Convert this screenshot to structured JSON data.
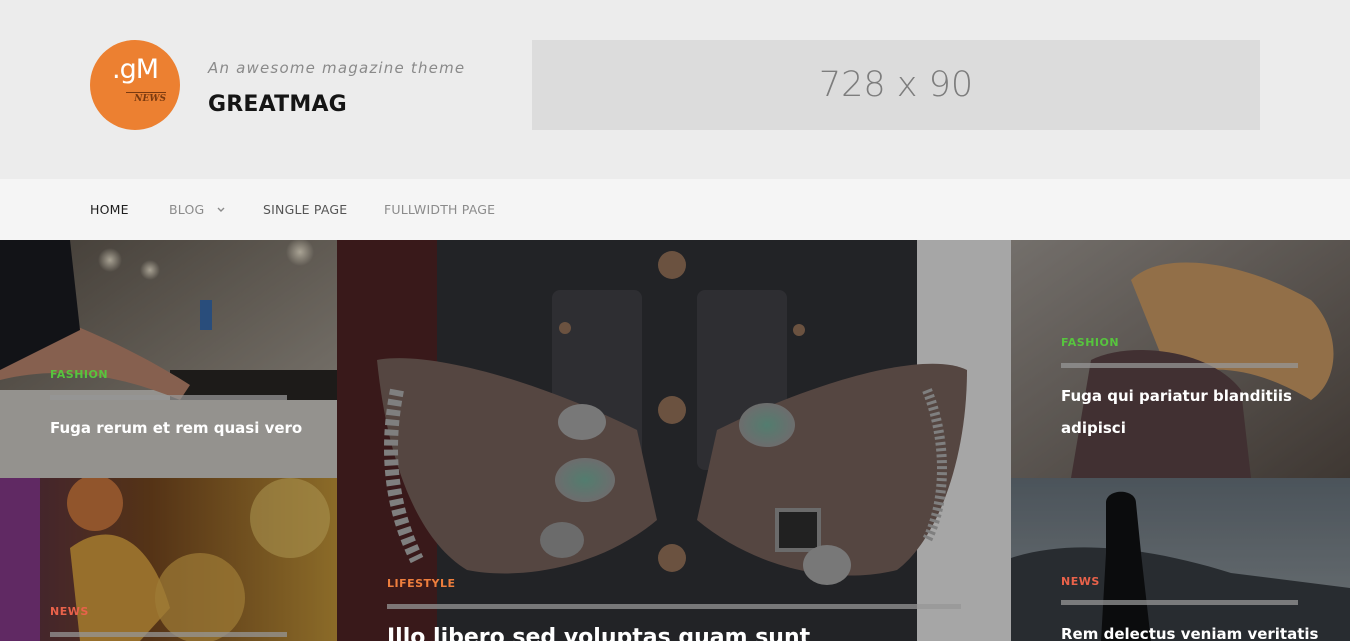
{
  "site": {
    "logo_mark": ".gM",
    "logo_sub": "NEWS",
    "tagline": "An awesome magazine theme",
    "title": "GREATMAG",
    "ad_label": "728 x 90"
  },
  "nav": {
    "items": [
      {
        "label": "HOME"
      },
      {
        "label": "BLOG"
      },
      {
        "label": "SINGLE PAGE"
      },
      {
        "label": "FULLWIDTH PAGE"
      }
    ]
  },
  "posts": [
    {
      "category": "FASHION",
      "title": "Fuga rerum et rem quasi vero"
    },
    {
      "category": "NEWS",
      "title": ""
    },
    {
      "category": "LIFESTYLE",
      "title": "Illo libero sed voluptas quam sunt"
    },
    {
      "category": "FASHION",
      "title": "Fuga qui pariatur blanditiis adipisci"
    },
    {
      "category": "NEWS",
      "title": "Rem delectus veniam veritatis"
    }
  ],
  "colors": {
    "accent_orange": "#ec8031",
    "category_fashion": "#57c43e",
    "category_news": "#e9624a",
    "category_lifestyle": "#ee7e3d"
  }
}
